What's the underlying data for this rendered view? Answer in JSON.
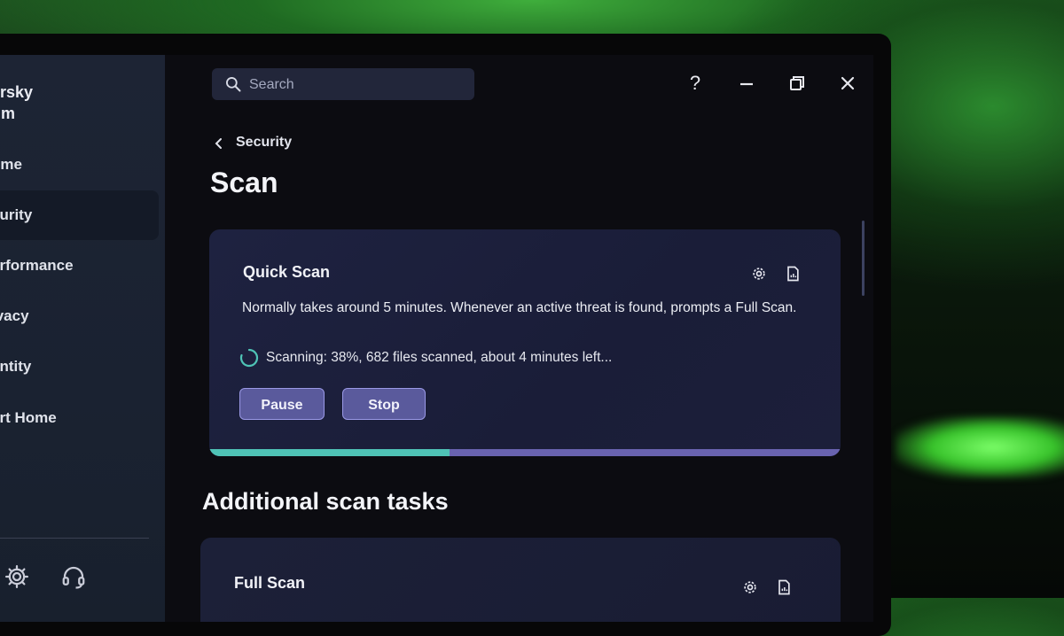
{
  "app": {
    "brand_line1": "ersky",
    "brand_line2": "um"
  },
  "sidebar": {
    "items": [
      {
        "label": "ome",
        "active": false
      },
      {
        "label": "curity",
        "active": true
      },
      {
        "label": "erformance",
        "active": false
      },
      {
        "label": "ivacy",
        "active": false
      },
      {
        "label": "entity",
        "active": false
      },
      {
        "label": "art Home",
        "active": false
      }
    ],
    "bottom_icons": [
      "gear-icon",
      "headset-icon"
    ]
  },
  "topbar": {
    "search_placeholder": "Search",
    "help_label": "?"
  },
  "breadcrumb": {
    "label": "Security"
  },
  "page": {
    "title": "Scan"
  },
  "quick_scan": {
    "title": "Quick Scan",
    "description": "Normally takes around 5 minutes. Whenever an active threat is found, prompts a Full Scan.",
    "status": "Scanning: 38%, 682 files scanned, about 4 minutes left...",
    "progress": 0.38,
    "pause_label": "Pause",
    "stop_label": "Stop"
  },
  "additional": {
    "title": "Additional scan tasks",
    "tasks": [
      {
        "title": "Full Scan"
      }
    ]
  },
  "colors": {
    "accent": "#4fc3b6",
    "button_bg": "#5a5a9c",
    "progress_track": "#6963b0"
  }
}
